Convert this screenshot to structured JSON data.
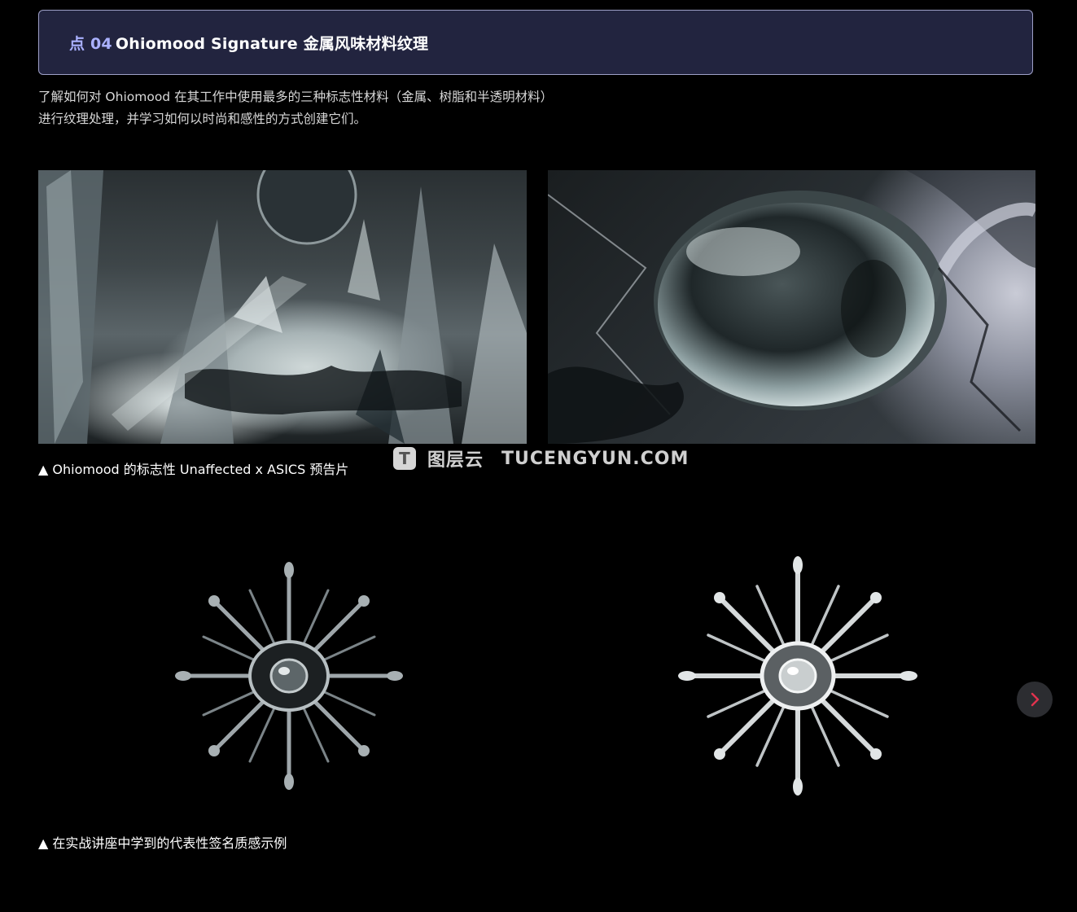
{
  "header": {
    "point_label": "点 04",
    "title": "Ohiomood Signature 金属风味材料纹理"
  },
  "description": {
    "line1": "了解如何对 Ohiomood 在其工作中使用最多的三种标志性材料（金属、树脂和半透明材料）",
    "line2": "进行纹理处理，并学习如何以时尚和感性的方式创建它们。"
  },
  "captions": {
    "first": "▲ Ohiomood 的标志性 Unaffected x ASICS 预告片",
    "second": "▲ 在实战讲座中学到的代表性签名质感示例"
  },
  "watermark": {
    "logo_letter": "T",
    "cn": "图层云",
    "en": "TUCENGYUN.COM"
  },
  "colors": {
    "background": "#000000",
    "header_bg": "#22243f",
    "header_border": "#9ea0c8",
    "point_accent": "#aab1ff",
    "next_arrow": "#e0324e"
  },
  "icons": {
    "next": "chevron-right-icon"
  }
}
